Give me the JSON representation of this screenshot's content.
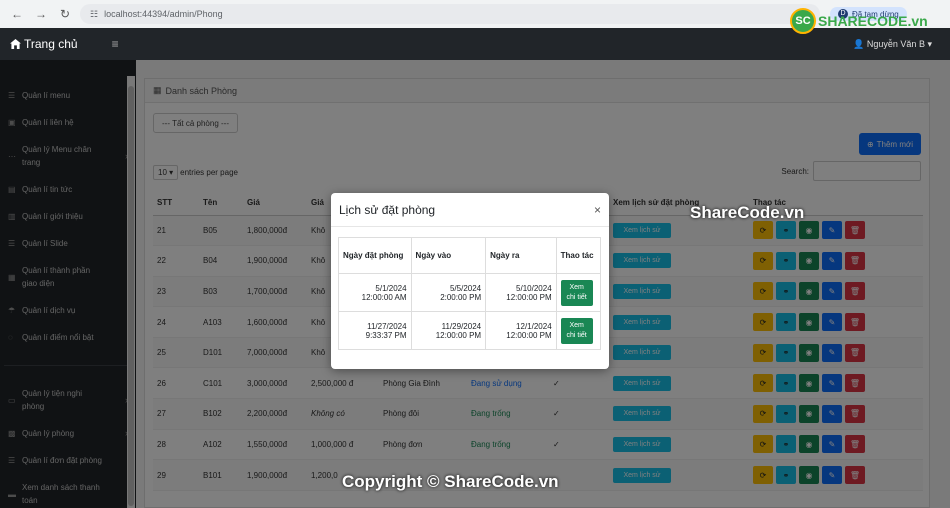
{
  "browser": {
    "url": "localhost:44394/admin/Phong",
    "paused_label": "Đã tạm dừng",
    "profile_letter": "D"
  },
  "topbar": {
    "brand": "Trang chủ",
    "user": "Nguyễn Văn B"
  },
  "sidebar": {
    "items": [
      {
        "label": "Quản lí menu",
        "icon": "list-icon",
        "lines": [
          "Quản lí menu"
        ]
      },
      {
        "label": "Quản lí liên hệ",
        "icon": "contact-icon",
        "lines": [
          "Quản lí liên hệ"
        ]
      },
      {
        "label": "Quản lý Menu chân trang",
        "icon": "dots-icon",
        "lines": [
          "Quản lý Menu chân",
          "trang"
        ],
        "chevron": true
      },
      {
        "label": "Quản lí tin tức",
        "icon": "news-icon",
        "lines": [
          "Quản lí tin tức"
        ]
      },
      {
        "label": "Quản lí giới thiệu",
        "icon": "file-icon",
        "lines": [
          "Quản lí giới thiệu"
        ]
      },
      {
        "label": "Quản lí Slide",
        "icon": "list-icon",
        "lines": [
          "Quản lí Slide"
        ]
      },
      {
        "label": "Quản lí thành phần giao diện",
        "icon": "layout-icon",
        "lines": [
          "Quản lí thành phần",
          "giao diện"
        ]
      },
      {
        "label": "Quản lí dịch vụ",
        "icon": "umbrella-icon",
        "lines": [
          "Quản lí dịch vụ"
        ]
      },
      {
        "label": "Quản lí điểm nổi bật",
        "icon": "spinner-icon",
        "lines": [
          "Quản lí điểm nổi bật"
        ]
      },
      {
        "label": "Quản lý tiện nghi phòng",
        "icon": "couch-icon",
        "lines": [
          "Quản lý tiện nghi",
          "phòng"
        ],
        "chevron": true
      },
      {
        "label": "Quản lý phòng",
        "icon": "building-icon",
        "lines": [
          "Quản lý phòng"
        ],
        "chevron": true
      },
      {
        "label": "Quản lí đơn đặt phòng",
        "icon": "list-icon",
        "lines": [
          "Quản lí đơn đặt phòng"
        ]
      },
      {
        "label": "Xem danh sách thanh toán",
        "icon": "money-icon",
        "lines": [
          "Xem danh sách thanh",
          "toán"
        ]
      }
    ]
  },
  "main": {
    "card_title": "Danh sách Phòng",
    "filter": "--- Tất cả phòng ---",
    "add_button": "Thêm mới",
    "entries_value": "10",
    "entries_label": "entries per page",
    "search_label": "Search:",
    "columns": [
      "STT",
      "Tên",
      "Giá",
      "Giá",
      "",
      "",
      "",
      "Xem lịch sử đặt phòng",
      "Thao tác"
    ],
    "history_button": "Xem lịch sử",
    "rows": [
      {
        "stt": "21",
        "ten": "B05",
        "gia": "1,800,000đ",
        "gia2": "Khô",
        "loai": "",
        "trang_thai": "",
        "tt_class": "",
        "check": ""
      },
      {
        "stt": "22",
        "ten": "B04",
        "gia": "1,900,000đ",
        "gia2": "Khô",
        "loai": "",
        "trang_thai": "",
        "tt_class": "",
        "check": ""
      },
      {
        "stt": "23",
        "ten": "B03",
        "gia": "1,700,000đ",
        "gia2": "Khô",
        "loai": "",
        "trang_thai": "",
        "tt_class": "",
        "check": ""
      },
      {
        "stt": "24",
        "ten": "A103",
        "gia": "1,600,000đ",
        "gia2": "Khô",
        "loai": "",
        "trang_thai": "",
        "tt_class": "",
        "check": ""
      },
      {
        "stt": "25",
        "ten": "D101",
        "gia": "7,000,000đ",
        "gia2": "Khô",
        "loai": "",
        "trang_thai": "",
        "tt_class": "",
        "check": ""
      },
      {
        "stt": "26",
        "ten": "C101",
        "gia": "3,000,000đ",
        "gia2": "2,500,000 đ",
        "loai": "Phòng Gia Đình",
        "trang_thai": "Đang sử dụng",
        "tt_class": "st-use",
        "check": "✓"
      },
      {
        "stt": "27",
        "ten": "B102",
        "gia": "2,200,000đ",
        "gia2": "Không có",
        "loai": "Phòng đôi",
        "trang_thai": "Đang trống",
        "tt_class": "st-ok",
        "check": "✓"
      },
      {
        "stt": "28",
        "ten": "A102",
        "gia": "1,550,000đ",
        "gia2": "1,000,000 đ",
        "loai": "Phòng đơn",
        "trang_thai": "Đang trống",
        "tt_class": "st-ok",
        "check": "✓"
      },
      {
        "stt": "29",
        "ten": "B101",
        "gia": "1,900,000đ",
        "gia2": "1,200,0",
        "loai": "",
        "trang_thai": "",
        "tt_class": "",
        "check": ""
      }
    ]
  },
  "modal": {
    "title": "Lịch sử đặt phòng",
    "close": "×",
    "columns": [
      "Ngày đặt phòng",
      "Ngày vào",
      "Ngày ra",
      "Thao tác"
    ],
    "view_button": "Xem chi tiết",
    "rows": [
      {
        "dat": [
          "5/1/2024",
          "12:00:00 AM"
        ],
        "vao": [
          "5/5/2024",
          "2:00:00 PM"
        ],
        "ra": [
          "5/10/2024",
          "12:00:00 PM"
        ]
      },
      {
        "dat": [
          "11/27/2024",
          "9:33:37 PM"
        ],
        "vao": [
          "11/29/2024",
          "12:00:00 PM"
        ],
        "ra": [
          "12/1/2024",
          "12:00:00 PM"
        ]
      }
    ]
  },
  "watermark": {
    "logo": "SHARECODE.vn",
    "mid": "ShareCode.vn",
    "footer": "Copyright © ShareCode.vn"
  },
  "colors": {
    "sidebar": "#212529",
    "primary": "#0d6efd",
    "success": "#198754",
    "info": "#17c1e8",
    "warning": "#ffc107",
    "danger": "#dc3545"
  }
}
